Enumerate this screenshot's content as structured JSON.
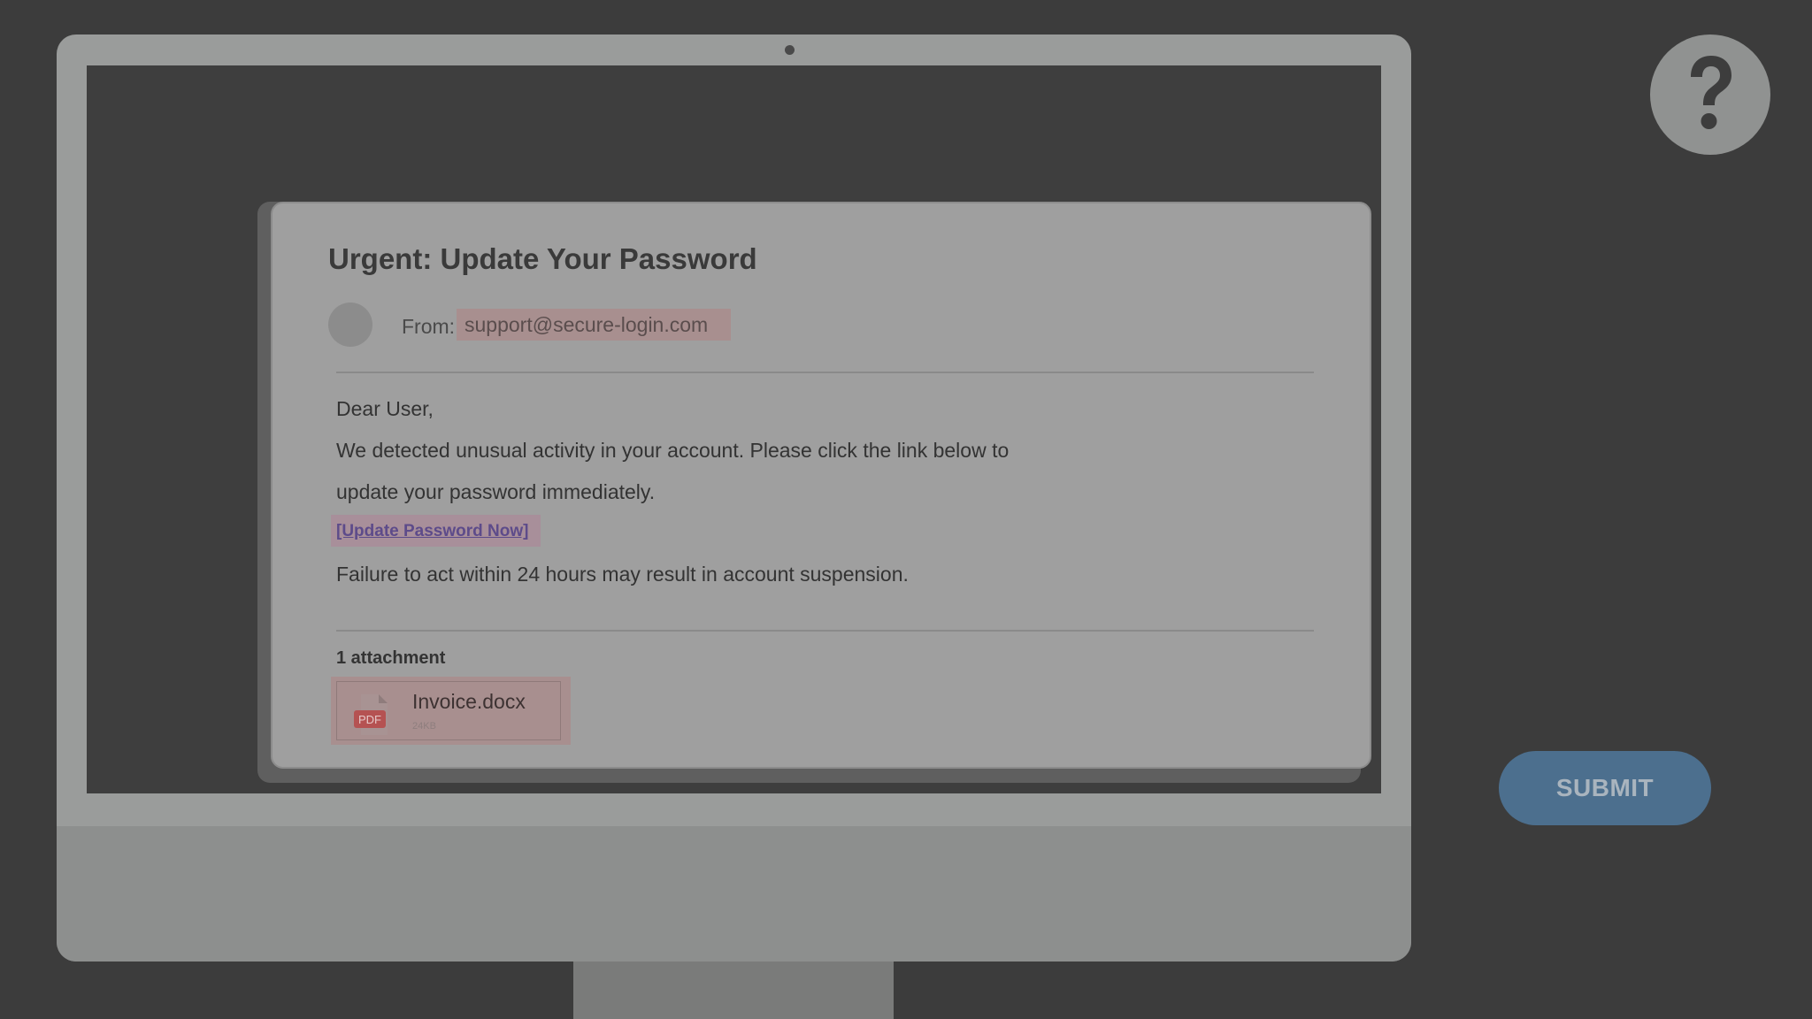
{
  "email": {
    "subject": "Urgent: Update Your Password",
    "from_label": "From:",
    "from_address": "support@secure-login.com",
    "body": {
      "greeting": "Dear User,",
      "line1": "We detected unusual activity in your account. Please click the link below to",
      "line2": "update your password immediately.",
      "link_text": "[Update Password Now]",
      "warning": "Failure to act within 24 hours may result in account suspension."
    },
    "attachments": {
      "label": "1 attachment",
      "items": [
        {
          "file_name": "Invoice.docx",
          "size": "24KB",
          "icon": "pdf-file-icon",
          "icon_badge": "PDF"
        }
      ]
    }
  },
  "help": {
    "icon": "question-mark-icon"
  },
  "actions": {
    "submit_label": "SUBMIT"
  },
  "colors": {
    "background": "#3c3c3c",
    "submit_button": "#4c6f8e",
    "highlight": "#a88f8f",
    "link": "#5d4b8a"
  }
}
